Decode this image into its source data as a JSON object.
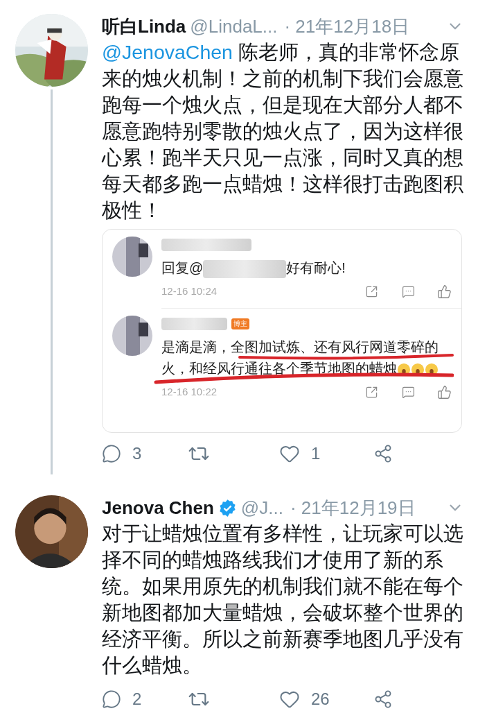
{
  "tweets": [
    {
      "name": "听白Linda",
      "handle": "@LindaL...",
      "date": "· 21年12月18日",
      "verified": false,
      "thread_line": true,
      "mention": "@JenovaChen",
      "text": " 陈老师，真的非常怀念原来的烛火机制！之前的机制下我们会愿意跑每一个烛火点，但是现在大部分人都不愿意跑特别零散的烛火点了，因为这样很心累！跑半天只见一点涨，同时又真的想每天都多跑一点蜡烛！这样很打击跑图积极性！",
      "embed": {
        "comments": [
          {
            "text": "回复@",
            "hidden_part": true,
            "text_after": "好有耐心!",
            "underlined": false,
            "emoji": false,
            "time": "12-16 10:24"
          },
          {
            "badge": "博主",
            "text": "是滴是滴，全图加试炼、还有风行网道零碎的火，和经风行通往各个季节地图的蜡烛",
            "hidden_part": false,
            "underlined": true,
            "emoji": true,
            "time": "12-16 10:22"
          }
        ]
      },
      "replies": "3",
      "likes": "1"
    },
    {
      "name": "Jenova Chen",
      "handle": "@J...",
      "date": "· 21年12月19日",
      "verified": true,
      "avatar": {
        "kind": "silhouette"
      },
      "thread_line": false,
      "text": "对于让蜡烛位置有多样性，让玩家可以选择不同的蜡烛路线我们才使用了新的系统。如果用原先的机制我们就不能在每个新地图都加大量蜡烛，会破坏整个世界的经济平衡。所以之前新赛季地图几乎没有什么蜡烛。",
      "replies": "2",
      "likes": "26"
    }
  ]
}
